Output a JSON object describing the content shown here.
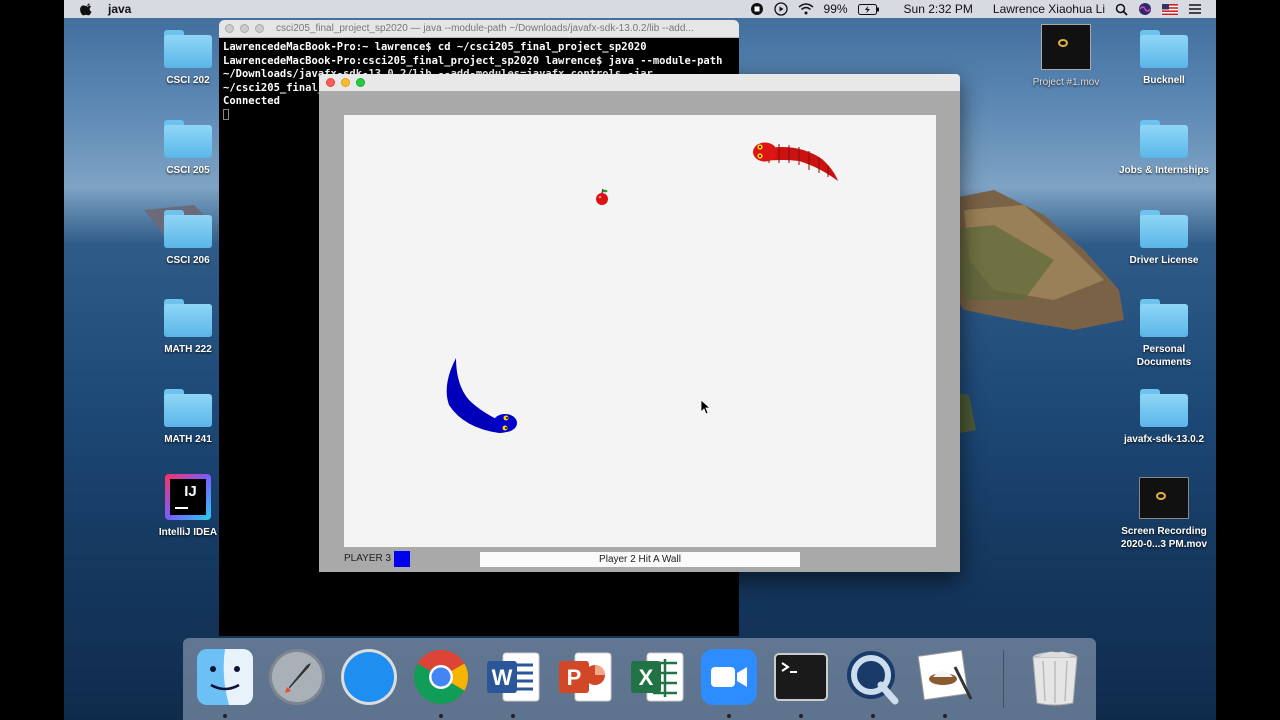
{
  "menubar": {
    "app_name": "java",
    "battery": "99%",
    "clock": "Sun 2:32 PM",
    "user": "Lawrence Xiaohua Li"
  },
  "desktop_icons_left": [
    {
      "label": "CSCI 202"
    },
    {
      "label": "CSCI 205"
    },
    {
      "label": "CSCI 206"
    },
    {
      "label": "MATH 222"
    },
    {
      "label": "MATH 241"
    },
    {
      "label": "IntelliJ IDEA"
    }
  ],
  "desktop_icons_right": [
    {
      "label": "Bucknell"
    },
    {
      "label": "Jobs & Internships"
    },
    {
      "label": "Driver License"
    },
    {
      "label": "Personal Documents"
    },
    {
      "label": "javafx-sdk-13.0.2"
    },
    {
      "label": "Screen Recording 2020-0...3 PM.mov"
    }
  ],
  "desktop_file_project": "Project #1.mov",
  "terminal": {
    "title": "csci205_final_project_sp2020 — java --module-path ~/Downloads/javafx-sdk-13.0.2/lib --add...",
    "lines": [
      "LawrencedeMacBook-Pro:~ lawrence$ cd ~/csci205_final_project_sp2020",
      "LawrencedeMacBook-Pro:csci205_final_project_sp2020 lawrence$ java --module-path ~/Downloads/javafx-sdk-13.0.2/lib --add-modules=javafx.controls -jar ~/csci205_final_project_sp",
      "Connected"
    ]
  },
  "game": {
    "player_label": "PLAYER 3",
    "player_color": "#0000ee",
    "status_message": "Player 2 Hit A Wall",
    "snake_red_color": "#cc1111",
    "snake_blue_color": "#0000bb"
  },
  "dock": {
    "apps": [
      "finder-icon",
      "launchpad-icon",
      "safari-icon",
      "chrome-icon",
      "word-icon",
      "powerpoint-icon",
      "excel-icon",
      "zoom-icon",
      "terminal-icon",
      "quicktime-icon",
      "preview-icon",
      "trash-icon"
    ]
  }
}
